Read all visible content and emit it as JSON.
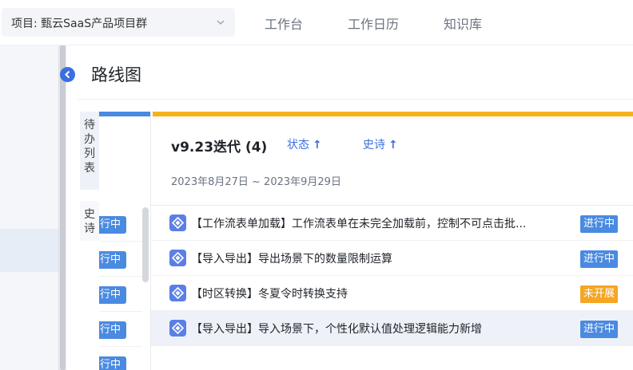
{
  "header": {
    "project_label": "项目: 甄云SaaS产品项目群",
    "nav": [
      "工作台",
      "工作日历",
      "知识库"
    ]
  },
  "page": {
    "title": "路线图"
  },
  "side_tabs": [
    "待办列表",
    "史诗"
  ],
  "backlog": {
    "badge_label": "行中",
    "rows": 5
  },
  "iteration": {
    "title": "v9.23迭代 (4)",
    "sort_status": "状态",
    "sort_epic": "史诗",
    "sort_arrow": "↑",
    "dates": "2023年8月27日  ~  2023年9月29日",
    "items": [
      {
        "text": "【工作流表单加载】工作流表单在未完全加载前，控制不可点击批...",
        "status": "进行中",
        "status_type": "doing"
      },
      {
        "text": "【导入导出】导出场景下的数量限制运算",
        "status": "进行中",
        "status_type": "doing"
      },
      {
        "text": "【时区转换】冬夏令时转换支持",
        "status": "未开展",
        "status_type": "todo"
      },
      {
        "text": "【导入导出】导入场景下，个性化默认值处理逻辑能力新增",
        "status": "进行中",
        "status_type": "doing"
      }
    ]
  },
  "colors": {
    "accent_blue": "#3b6fe0",
    "status_doing": "#4a8ae0",
    "status_todo": "#f5a623",
    "iteration_bar": "#f5b21b",
    "backlog_bar": "#4a8ae0"
  },
  "icons": {
    "project_dropdown": "chevron-down-icon",
    "collapse": "chevron-left-icon",
    "item_type": "epic-icon"
  }
}
